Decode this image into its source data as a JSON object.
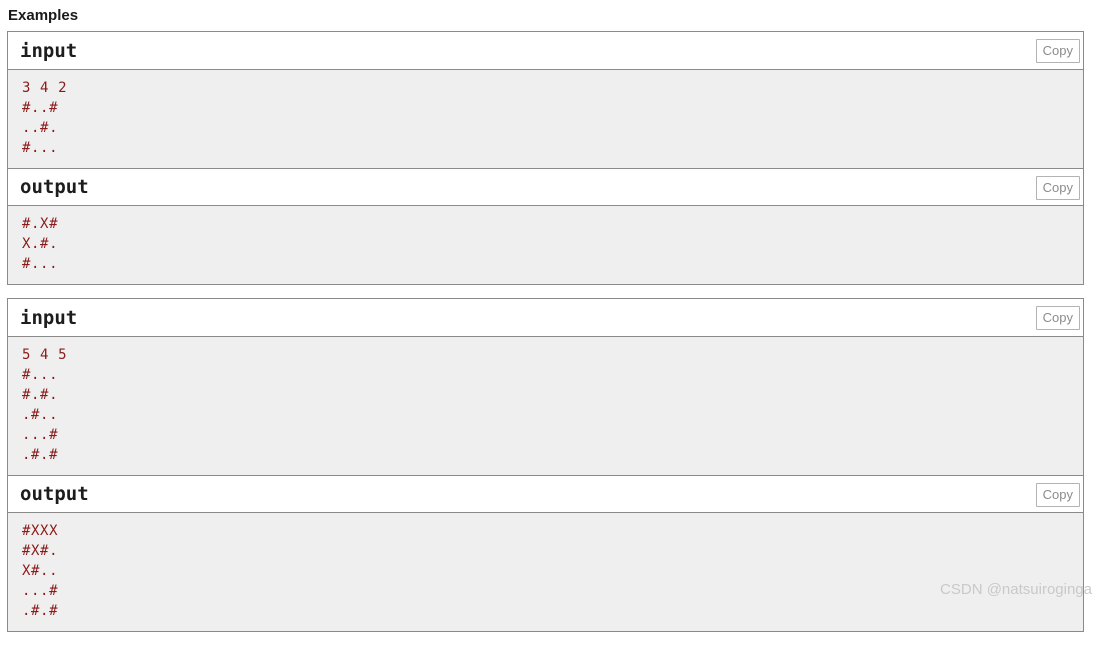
{
  "section": {
    "title": "Examples"
  },
  "copy_label": "Copy",
  "colors": {
    "code_text": "#8b1a1a",
    "code_background": "#efefef",
    "panel_border": "#8a8a8a",
    "header_text": "#1d1d1d",
    "copy_button_text": "#8c8c8c",
    "copy_button_border": "#b3b3b3",
    "watermark_text": "#c9c9c9",
    "page_background": "#ffffff"
  },
  "examples": [
    {
      "blocks": [
        {
          "title": "input",
          "copy_label": "Copy",
          "lines": [
            "3 4 2",
            "#..#",
            "..#.",
            "#..."
          ]
        },
        {
          "title": "output",
          "copy_label": "Copy",
          "lines": [
            "#.X#",
            "X.#.",
            "#..."
          ]
        }
      ]
    },
    {
      "blocks": [
        {
          "title": "input",
          "copy_label": "Copy",
          "lines": [
            "5 4 5",
            "#...",
            "#.#.",
            ".#..",
            "...#",
            ".#.#"
          ]
        },
        {
          "title": "output",
          "copy_label": "Copy",
          "lines": [
            "#XXX",
            "#X#.",
            "X#..",
            "...#",
            ".#.#"
          ]
        }
      ]
    }
  ],
  "watermark": {
    "text": "CSDN @natsuiroginga"
  }
}
